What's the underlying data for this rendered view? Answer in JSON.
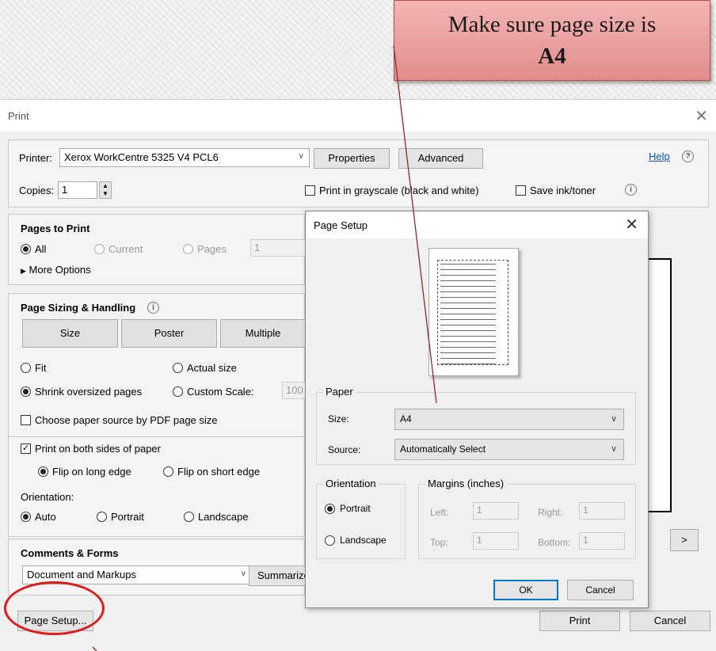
{
  "callout": {
    "line1": "Make sure page size is",
    "line2": "A4"
  },
  "print_dialog": {
    "title": "Print",
    "printer_label": "Printer:",
    "printer_value": "Xerox WorkCentre 5325 V4 PCL6",
    "properties_button": "Properties",
    "advanced_button": "Advanced",
    "help_link": "Help",
    "copies_label": "Copies:",
    "copies_value": "1",
    "grayscale_label": "Print in grayscale (black and white)",
    "save_ink_label": "Save ink/toner",
    "pages_to_print": {
      "heading": "Pages to Print",
      "all": "All",
      "current": "Current",
      "pages": "Pages",
      "pages_value": "1",
      "more_options": "More Options"
    },
    "page_sizing": {
      "heading": "Page Sizing & Handling",
      "size_button": "Size",
      "poster_button": "Poster",
      "multiple_button": "Multiple",
      "fit": "Fit",
      "actual_size": "Actual size",
      "shrink": "Shrink oversized pages",
      "custom_scale": "Custom Scale:",
      "custom_scale_value": "100",
      "paper_source": "Choose paper source by PDF page size",
      "both_sides": "Print on both sides of paper",
      "flip_long": "Flip on long edge",
      "flip_short": "Flip on short edge",
      "orientation_label": "Orientation:",
      "auto": "Auto",
      "portrait": "Portrait",
      "landscape": "Landscape"
    },
    "comments": {
      "heading": "Comments & Forms",
      "value": "Document and Markups",
      "summarize_button": "Summarize"
    },
    "page_setup_button": "Page Setup...",
    "next_button": ">",
    "print_button": "Print",
    "cancel_button": "Cancel"
  },
  "page_setup": {
    "title": "Page Setup",
    "paper_group": "Paper",
    "size_label": "Size:",
    "size_value": "A4",
    "source_label": "Source:",
    "source_value": "Automatically Select",
    "orientation_group": "Orientation",
    "portrait": "Portrait",
    "landscape": "Landscape",
    "margins_group": "Margins (inches)",
    "left_label": "Left:",
    "left_value": "1",
    "right_label": "Right:",
    "right_value": "1",
    "top_label": "Top:",
    "top_value": "1",
    "bottom_label": "Bottom:",
    "bottom_value": "1",
    "ok_button": "OK",
    "cancel_button": "Cancel"
  }
}
